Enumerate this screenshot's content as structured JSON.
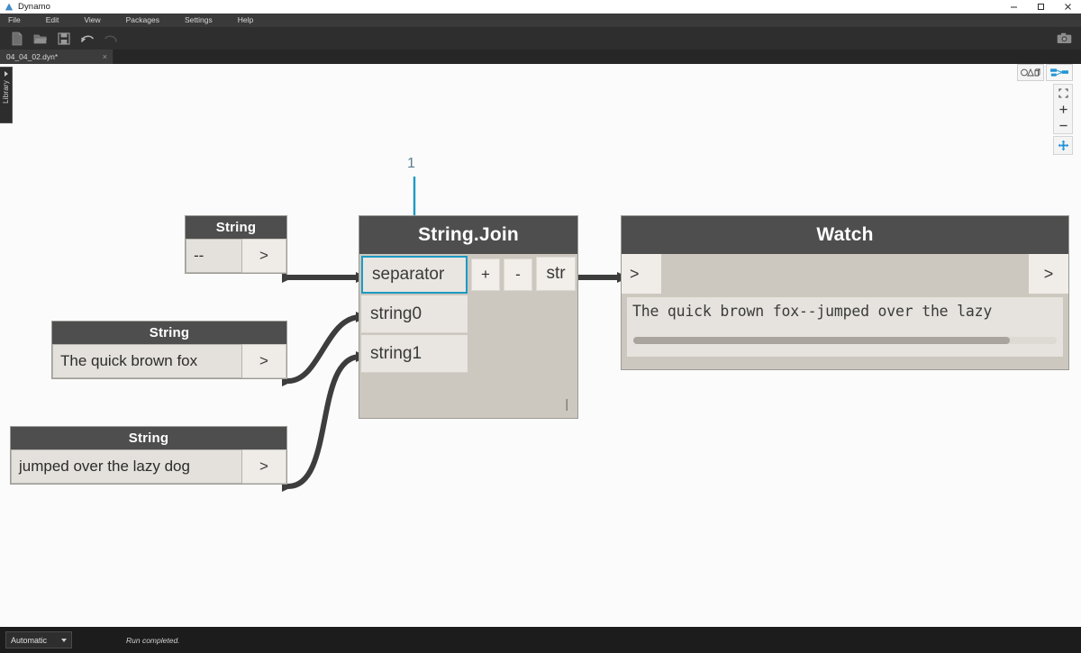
{
  "window": {
    "app_title": "Dynamo",
    "logo_icon": "dynamo-logo-icon",
    "controls": [
      {
        "name": "minimize",
        "icon": "minimize-icon"
      },
      {
        "name": "maximize",
        "icon": "maximize-icon"
      },
      {
        "name": "close",
        "icon": "close-icon"
      }
    ]
  },
  "menubar": {
    "items": [
      {
        "label": "File"
      },
      {
        "label": "Edit"
      },
      {
        "label": "View"
      },
      {
        "label": "Packages"
      },
      {
        "label": "Settings"
      },
      {
        "label": "Help"
      }
    ]
  },
  "toolbar": {
    "buttons": [
      {
        "name": "new-file-button",
        "icon": "new-file-icon"
      },
      {
        "name": "open-file-button",
        "icon": "open-folder-icon"
      },
      {
        "name": "save-button",
        "icon": "save-disk-icon"
      },
      {
        "name": "undo-button",
        "icon": "undo-arrow-icon"
      },
      {
        "name": "redo-button",
        "icon": "redo-arrow-icon"
      }
    ],
    "screenshot_button": {
      "name": "export-image-button",
      "icon": "camera-icon"
    }
  },
  "tabs": [
    {
      "label": "04_04_02.dyn*",
      "close_glyph": "×",
      "active": true
    }
  ],
  "library_panel": {
    "label": "Library",
    "expand_icon": "chevron-right-icon"
  },
  "canvas_controls": {
    "view_toggles": [
      {
        "name": "background-3d-preview-toggle",
        "icon": "geometry-3d-icon",
        "active": false
      },
      {
        "name": "graph-view-toggle",
        "icon": "node-graph-icon",
        "active": true
      }
    ],
    "zoom": [
      {
        "name": "zoom-to-fit-button",
        "icon": "fit-to-screen-icon",
        "label": ""
      },
      {
        "name": "zoom-in-button",
        "icon": "plus-icon",
        "label": "+"
      },
      {
        "name": "zoom-out-button",
        "icon": "minus-icon",
        "label": "−"
      }
    ],
    "pan": {
      "name": "pan-tool-button",
      "icon": "pan-move-icon"
    }
  },
  "annotation": {
    "marker_label": "1",
    "color": "#1c9ac4"
  },
  "nodes": {
    "string_separator": {
      "title": "String",
      "value": "--",
      "output_glyph": ">"
    },
    "string_fox": {
      "title": "String",
      "value": "The quick brown fox",
      "output_glyph": ">"
    },
    "string_dog": {
      "title": "String",
      "value": "jumped over the lazy dog",
      "output_glyph": ">"
    },
    "string_join": {
      "title": "String.Join",
      "inputs": [
        {
          "label": "separator",
          "selected": true
        },
        {
          "label": "string0",
          "selected": false
        },
        {
          "label": "string1",
          "selected": false
        }
      ],
      "add_port_label": "+",
      "remove_port_label": "-",
      "output_label": "str",
      "resize_glyph": "|"
    },
    "watch": {
      "title": "Watch",
      "input_glyph": ">",
      "output_glyph": ">",
      "result_text": "The quick brown fox--jumped over the lazy"
    }
  },
  "statusbar": {
    "run_mode": "Automatic",
    "run_mode_caret": "caret-down-icon",
    "status_message": "Run completed."
  },
  "colors": {
    "accent": "#1c9ac4",
    "node_header": "#4e4e4e",
    "node_body": "#ccc8bf",
    "wire": "#3d3d3d",
    "chrome_dark": "#2e2e2e"
  }
}
